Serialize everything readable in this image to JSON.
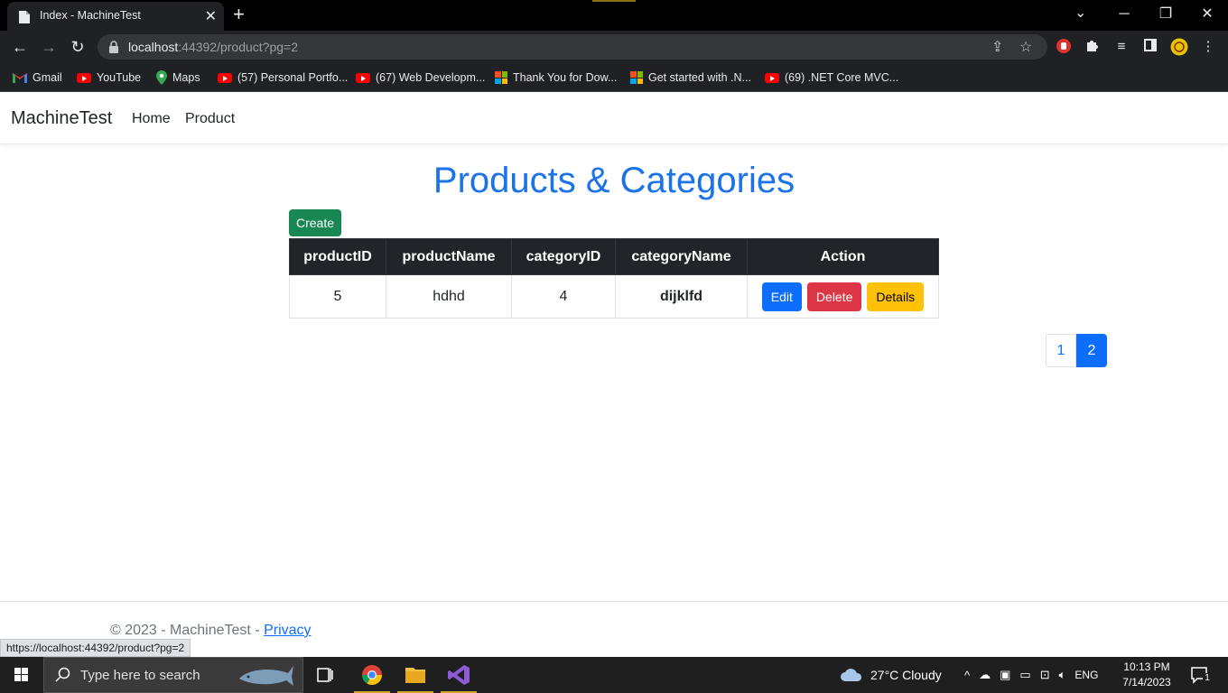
{
  "browser": {
    "tab_title": "Index - MachineTest",
    "url_host": "localhost",
    "url_path": ":44392/product?pg=2",
    "status_url": "https://localhost:44392/product?pg=2",
    "bookmarks": [
      {
        "label": "Gmail",
        "icon": "gmail-icon"
      },
      {
        "label": "YouTube",
        "icon": "youtube-icon"
      },
      {
        "label": "Maps",
        "icon": "maps-icon"
      },
      {
        "label": "(57) Personal Portfo...",
        "icon": "youtube-icon"
      },
      {
        "label": "(67) Web Developm...",
        "icon": "youtube-icon"
      },
      {
        "label": "Thank You for Dow...",
        "icon": "microsoft-icon"
      },
      {
        "label": "Get started with .N...",
        "icon": "microsoft-icon"
      },
      {
        "label": "(69) .NET Core MVC...",
        "icon": "youtube-icon"
      }
    ]
  },
  "navbar": {
    "brand": "MachineTest",
    "links": [
      "Home",
      "Product"
    ]
  },
  "main": {
    "heading": "Products & Categories",
    "create_label": "Create",
    "columns": [
      "productID",
      "productName",
      "categoryID",
      "categoryName",
      "Action"
    ],
    "rows": [
      {
        "productID": "5",
        "productName": "hdhd",
        "categoryID": "4",
        "categoryName": "dijklfd"
      }
    ],
    "actions": {
      "edit": "Edit",
      "delete": "Delete",
      "details": "Details"
    },
    "pagination": {
      "pages": [
        "1",
        "2"
      ],
      "current": "2"
    }
  },
  "footer": {
    "copyright": "© 2023 - MachineTest - ",
    "privacy": "Privacy"
  },
  "taskbar": {
    "search_placeholder": "Type here to search",
    "weather": "27°C  Cloudy",
    "language": "ENG",
    "time": "10:13 PM",
    "date": "7/14/2023",
    "notification_count": "1"
  },
  "colors": {
    "heading": "#1a73e8",
    "create": "#198754",
    "edit": "#0d6efd",
    "delete": "#dc3545",
    "details": "#ffc107",
    "table_header": "#212529"
  }
}
